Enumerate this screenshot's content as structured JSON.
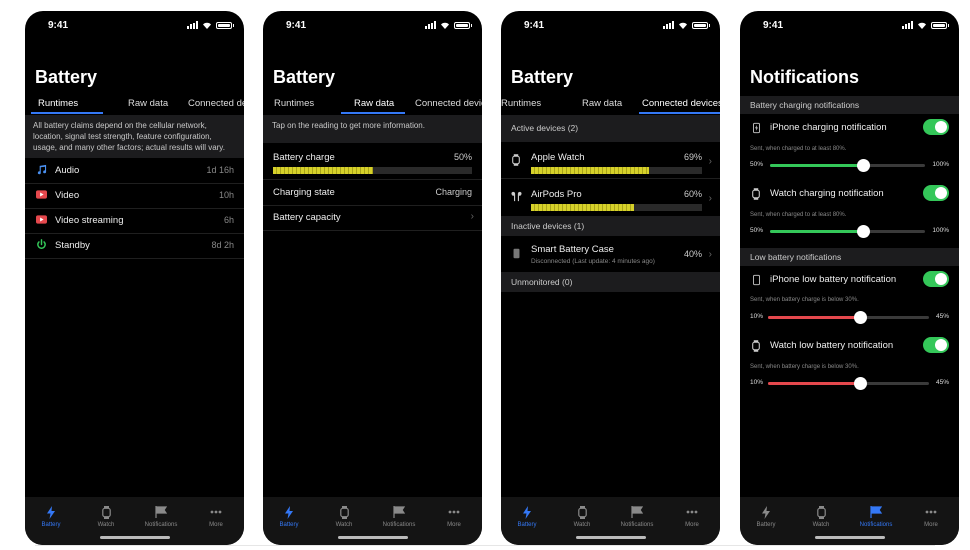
{
  "status": {
    "time": "9:41"
  },
  "tabbar": {
    "battery": "Battery",
    "watch": "Watch",
    "notifications": "Notifications",
    "more": "More"
  },
  "screens": [
    {
      "title": "Battery",
      "tabs": [
        "Runtimes",
        "Raw data",
        "Connected devices"
      ],
      "banner": "All battery claims depend on the cellular network, location, signal test strength, feature configuration, usage, and many other factors; actual results will vary.",
      "rows": [
        {
          "label": "Audio",
          "value": "1d 16h",
          "icon": "music-note-icon"
        },
        {
          "label": "Video",
          "value": "10h",
          "icon": "video-play-icon"
        },
        {
          "label": "Video streaming",
          "value": "6h",
          "icon": "video-stream-icon"
        },
        {
          "label": "Standby",
          "value": "8d 2h",
          "icon": "power-icon"
        }
      ]
    },
    {
      "title": "Battery",
      "tabs": [
        "Runtimes",
        "Raw data",
        "Connected devices"
      ],
      "banner": "Tap on the reading to get more information.",
      "battery_charge": {
        "label": "Battery charge",
        "value": "50%",
        "level": 0.5
      },
      "charging_state": {
        "label": "Charging state",
        "value": "Charging"
      },
      "battery_capacity": {
        "label": "Battery capacity"
      }
    },
    {
      "title": "Battery",
      "tabs": [
        "Runtimes",
        "Raw data",
        "Connected devices"
      ],
      "active_header": "Active devices (2)",
      "active": [
        {
          "name": "Apple Watch",
          "value": "69%",
          "level": 0.69,
          "icon": "watch-icon"
        },
        {
          "name": "AirPods Pro",
          "value": "60%",
          "level": 0.6,
          "icon": "airpods-icon"
        }
      ],
      "inactive_header": "Inactive devices (1)",
      "inactive": {
        "name": "Smart Battery Case",
        "value": "40%",
        "sub": "Disconnected (Last update: 4 minutes ago)"
      },
      "unmonitored_header": "Unmonitored (0)"
    },
    {
      "title": "Notifications",
      "charging_header": "Battery charging notifications",
      "charging": [
        {
          "label": "iPhone charging notification",
          "note": "Sent, when charged to at least 80%.",
          "min": "50%",
          "max": "100%",
          "level": 0.6,
          "icon": "iphone-bolt-icon"
        },
        {
          "label": "Watch charging notification",
          "note": "Sent, when charged to at least 80%.",
          "min": "50%",
          "max": "100%",
          "level": 0.6,
          "icon": "watch-icon"
        }
      ],
      "low_header": "Low battery notifications",
      "low": [
        {
          "label": "iPhone low battery notification",
          "note": "Sent, when battery charge is below 30%.",
          "min": "10%",
          "max": "45%",
          "level": 0.57,
          "icon": "iphone-icon"
        },
        {
          "label": "Watch low battery notification",
          "note": "Sent, when battery charge is below 30%.",
          "min": "10%",
          "max": "45%",
          "level": 0.57,
          "icon": "watch-icon"
        }
      ]
    }
  ],
  "colors": {
    "accent": "#3478f6",
    "green": "#34c759",
    "red": "#e5484d",
    "bar_yellow": "#d6d12a"
  }
}
